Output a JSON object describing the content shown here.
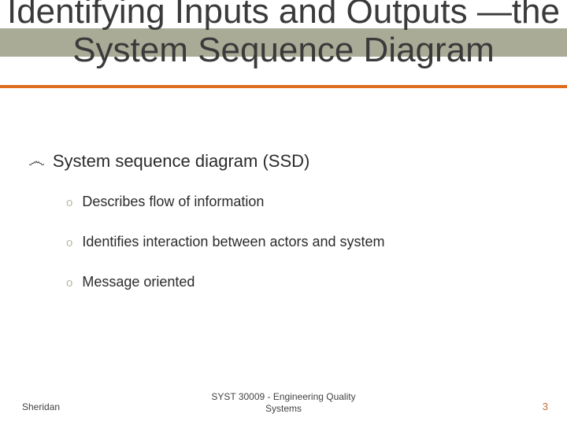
{
  "title": "Identifying Inputs and Outputs —the System Sequence Diagram",
  "main_bullet": "System sequence diagram (SSD)",
  "sub_bullets": [
    "Describes flow of information",
    "Identifies interaction between actors and system",
    "Message oriented"
  ],
  "footer": {
    "left": "Sheridan",
    "center_line1": "SYST 30009 - Engineering Quality",
    "center_line2": "Systems",
    "page": "3"
  }
}
